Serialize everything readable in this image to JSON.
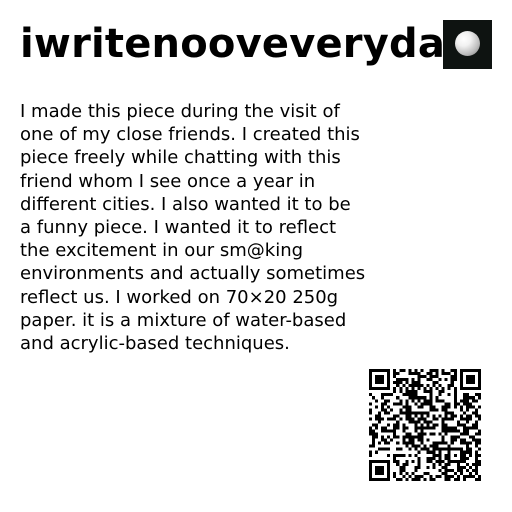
{
  "title": "iwritenooveveryday",
  "description": "I made this piece during the visit of\none of my close friends. I created this\npiece freely while chatting with this\nfriend whom I see once a year in\ndifferent cities. I also wanted it to be\na funny piece. I wanted it to reflect\nthe excitement in our sm@king\nenvironments and actually sometimes\nreflect us. I worked on 70×20 250g\npaper. it is a mixture of water-based\nand acrylic-based techniques.",
  "colors": {
    "text": "#000000",
    "background": "#ffffff",
    "thumbnail_background": "#0e1311"
  },
  "icons": {
    "thumbnail": "white-sphere-artwork-thumbnail",
    "qr": "qr-code"
  }
}
